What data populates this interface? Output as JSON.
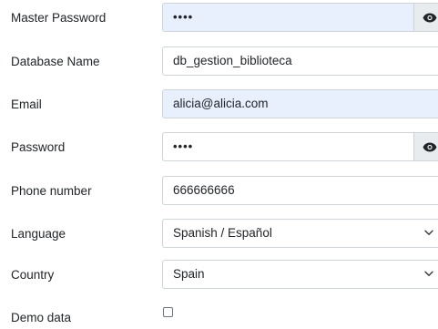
{
  "fields": {
    "master_password": {
      "label": "Master Password",
      "value": "••••"
    },
    "database_name": {
      "label": "Database Name",
      "value": "db_gestion_biblioteca"
    },
    "email": {
      "label": "Email",
      "value": "alicia@alicia.com"
    },
    "password": {
      "label": "Password",
      "value": "••••"
    },
    "phone": {
      "label": "Phone number",
      "value": "666666666"
    },
    "language": {
      "label": "Language",
      "selected": "Spanish / Español"
    },
    "country": {
      "label": "Country",
      "selected": "Spain"
    },
    "demo_data": {
      "label": "Demo data",
      "checked": false
    }
  },
  "icons": {
    "eye": "eye-icon",
    "chevron": "chevron-down-icon"
  },
  "colors": {
    "autofill_bg": "#e8f0fe",
    "border": "#ced4da",
    "addon_bg": "#e9ecef",
    "text": "#212529"
  }
}
